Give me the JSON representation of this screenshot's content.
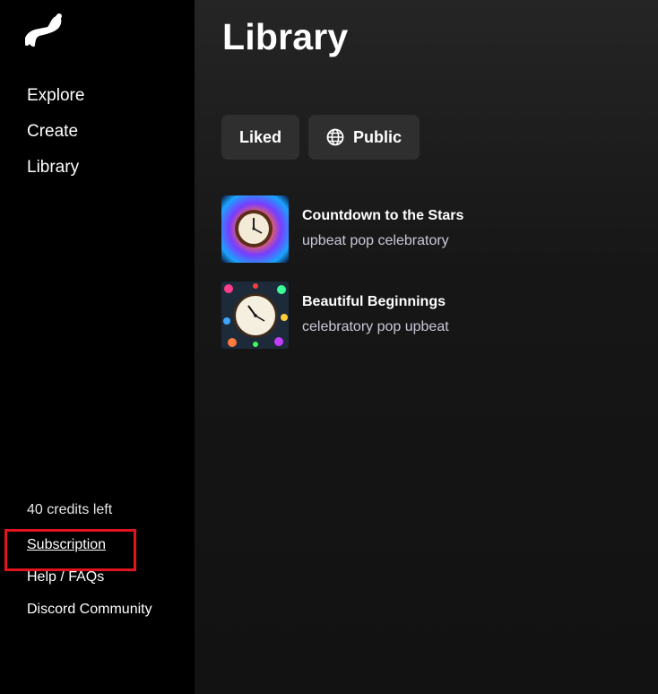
{
  "sidebar": {
    "logo": "suno-wave-logo",
    "nav": [
      {
        "label": "Explore"
      },
      {
        "label": "Create"
      },
      {
        "label": "Library"
      }
    ],
    "credits": "40 credits left",
    "subscription": "Subscription",
    "help": "Help / FAQs",
    "discord": "Discord Community"
  },
  "main": {
    "title": "Library",
    "filters": [
      {
        "label": "Liked",
        "icon": null
      },
      {
        "label": "Public",
        "icon": "globe-icon"
      }
    ],
    "songs": [
      {
        "title": "Countdown to the Stars",
        "tags": "upbeat pop celebratory"
      },
      {
        "title": "Beautiful Beginnings",
        "tags": "celebratory pop upbeat"
      }
    ]
  },
  "colors": {
    "sidebar_bg": "#000000",
    "main_bg": "#121212",
    "button_bg": "#2f2f2f",
    "highlight": "#e0141e"
  }
}
